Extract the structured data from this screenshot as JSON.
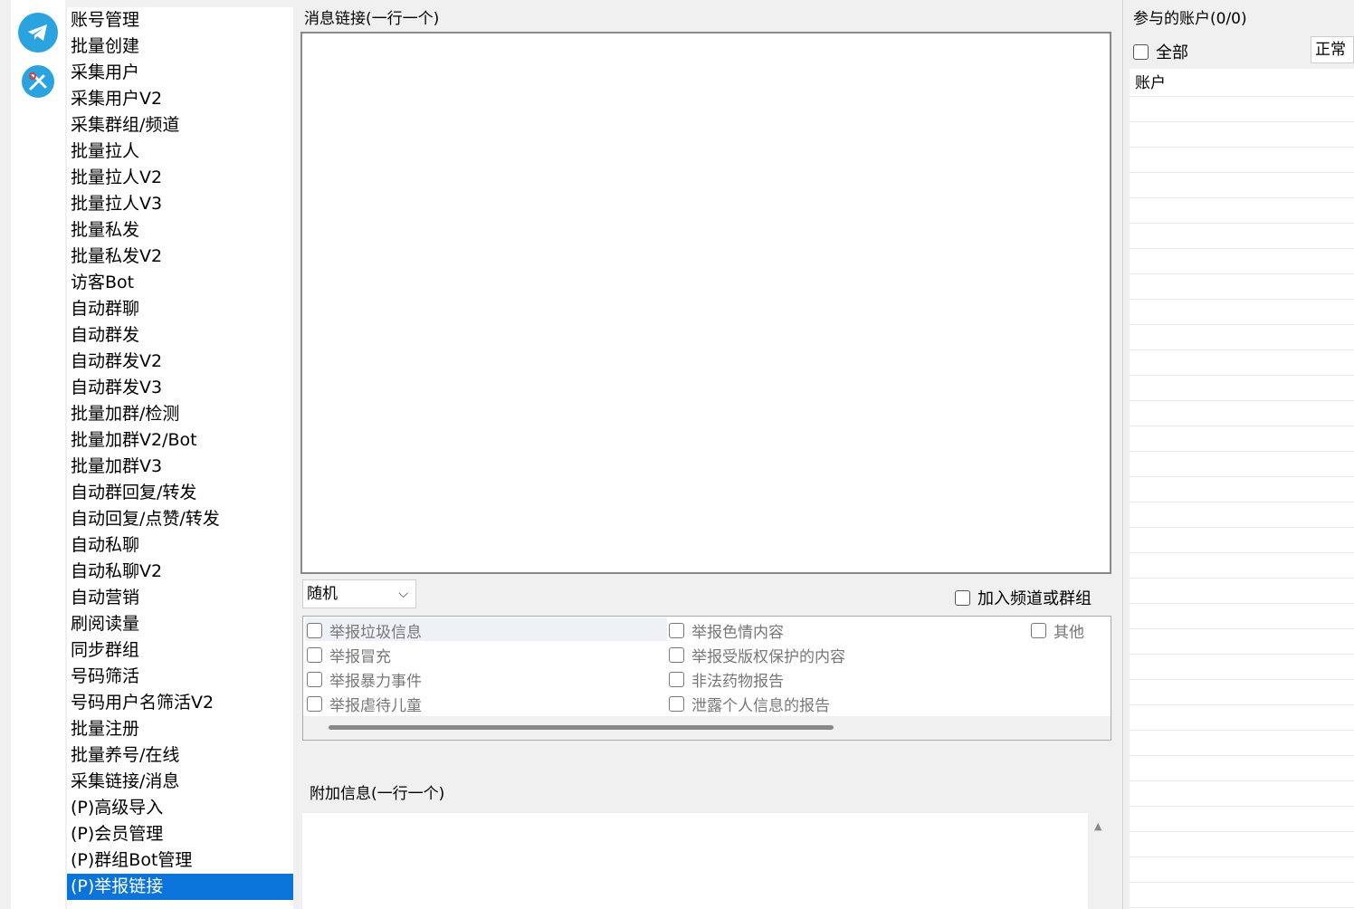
{
  "nav": {
    "items": [
      "账号管理",
      "批量创建",
      "采集用户",
      "采集用户V2",
      "采集群组/频道",
      "批量拉人",
      "批量拉人V2",
      "批量拉人V3",
      "批量私发",
      "批量私发V2",
      "访客Bot",
      "自动群聊",
      "自动群发",
      "自动群发V2",
      "自动群发V3",
      "批量加群/检测",
      "批量加群V2/Bot",
      "批量加群V3",
      "自动群回复/转发",
      "自动回复/点赞/转发",
      "自动私聊",
      "自动私聊V2",
      "自动营销",
      "刷阅读量",
      "同步群组",
      "号码筛活",
      "号码用户名筛活V2",
      "批量注册",
      "批量养号/在线",
      "采集链接/消息",
      "(P)高级导入",
      "(P)会员管理",
      "(P)群组Bot管理",
      "(P)举报链接"
    ],
    "selected_index": 33
  },
  "main": {
    "links_label": "消息链接(一行一个)",
    "mode_select": "随机",
    "join_label": "加入频道或群组",
    "report_options": {
      "col1": [
        "举报垃圾信息",
        "举报冒充",
        "举报暴力事件",
        "举报虐待儿童"
      ],
      "col2": [
        "举报色情内容",
        "举报受版权保护的内容",
        "非法药物报告",
        "泄露个人信息的报告"
      ],
      "col3": [
        "其他"
      ]
    },
    "extra_label": "附加信息(一行一个)"
  },
  "accounts": {
    "title": "参与的账户(0/0)",
    "all_label": "全部",
    "filter_value": "正常",
    "column_header": "账户"
  },
  "colors": {
    "accent": "#0a74da",
    "icon_bg": "#2aa3df"
  }
}
